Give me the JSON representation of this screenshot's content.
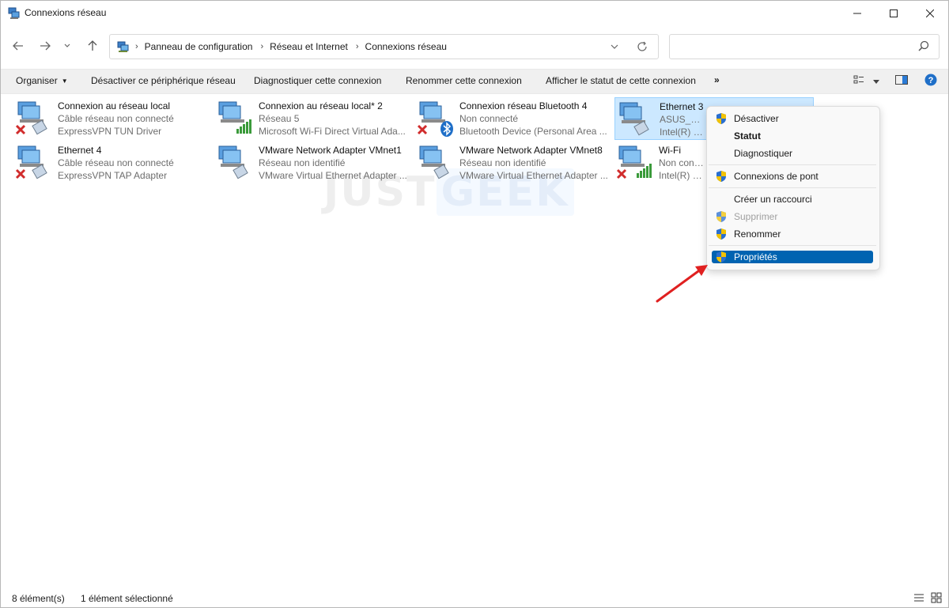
{
  "window": {
    "title": "Connexions réseau"
  },
  "nav": {
    "breadcrumb": [
      "Panneau de configuration",
      "Réseau et Internet",
      "Connexions réseau"
    ],
    "search_placeholder": ""
  },
  "toolbar": {
    "organize": "Organiser",
    "disable": "Désactiver ce périphérique réseau",
    "diagnose": "Diagnostiquer cette connexion",
    "rename": "Renommer cette connexion",
    "status": "Afficher le statut de cette connexion",
    "more": "»"
  },
  "connections": [
    {
      "name": "Connexion au réseau local",
      "status": "Câble réseau non connecté",
      "device": "ExpressVPN TUN Driver",
      "overlay": "red-x"
    },
    {
      "name": "Connexion au réseau local* 2",
      "status": "Réseau 5",
      "device": "Microsoft Wi-Fi Direct Virtual Ada...",
      "overlay": "signal-bars"
    },
    {
      "name": "Connexion réseau Bluetooth 4",
      "status": "Non connecté",
      "device": "Bluetooth Device (Personal Area ...",
      "overlay": "red-x-bluetooth"
    },
    {
      "name": "Ethernet 3",
      "status": "ASUS_ROG",
      "device": "Intel(R) Eth",
      "overlay": "none",
      "selected": true
    },
    {
      "name": "Ethernet 4",
      "status": "Câble réseau non connecté",
      "device": "ExpressVPN TAP Adapter",
      "overlay": "red-x"
    },
    {
      "name": "VMware Network Adapter VMnet1",
      "status": "Réseau non identifié",
      "device": "VMware Virtual Ethernet Adapter ...",
      "overlay": "none"
    },
    {
      "name": "VMware Network Adapter VMnet8",
      "status": "Réseau non identifié",
      "device": "VMware Virtual Ethernet Adapter ...",
      "overlay": "none"
    },
    {
      "name": "Wi-Fi",
      "status": "Non conne",
      "device": "Intel(R) Wi-",
      "overlay": "red-x-signal"
    }
  ],
  "context_menu": {
    "items": [
      {
        "label": "Désactiver",
        "shield": true,
        "bold": false,
        "disabled": false
      },
      {
        "label": "Statut",
        "shield": false,
        "bold": true,
        "disabled": false
      },
      {
        "label": "Diagnostiquer",
        "shield": false,
        "bold": false,
        "disabled": false
      },
      {
        "label": "Connexions de pont",
        "shield": true,
        "bold": false,
        "disabled": false
      },
      {
        "label": "Créer un raccourci",
        "shield": false,
        "bold": false,
        "disabled": false
      },
      {
        "label": "Supprimer",
        "shield": true,
        "bold": false,
        "disabled": true
      },
      {
        "label": "Renommer",
        "shield": true,
        "bold": false,
        "disabled": false
      },
      {
        "label": "Propriétés",
        "shield": true,
        "bold": false,
        "disabled": false,
        "highlighted": true
      }
    ]
  },
  "watermark": {
    "part1": "JUST",
    "part2": "GEEK"
  },
  "status": {
    "count": "8 élément(s)",
    "selection": "1 élément sélectionné"
  },
  "colors": {
    "accent": "#0063b1",
    "selection_bg": "#cce8ff",
    "arrow": "#e02020",
    "error": "#d12c2c",
    "signal": "#3a9a3a"
  }
}
